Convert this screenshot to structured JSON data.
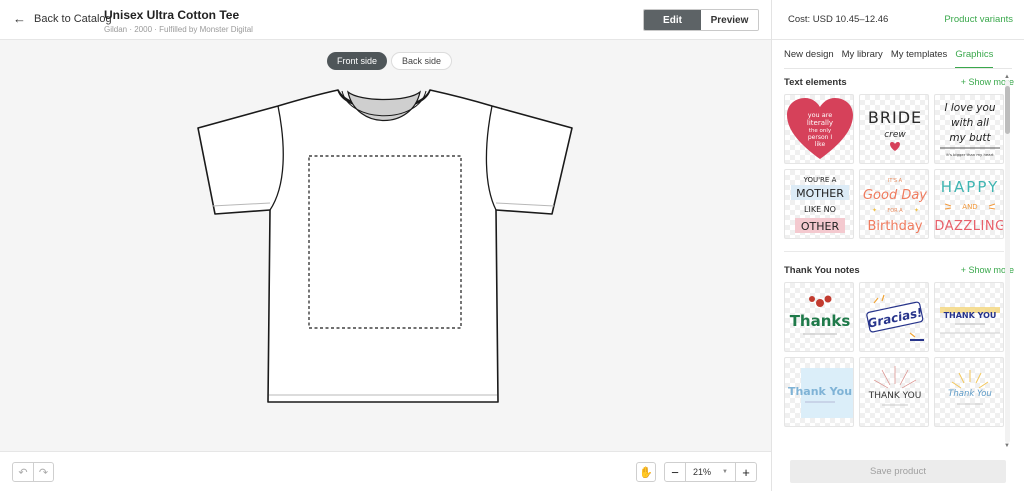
{
  "header": {
    "back_label": "Back to Catalog",
    "product_name": "Unisex Ultra Cotton Tee",
    "product_meta": "Gildan · 2000 · Fulfilled by Monster Digital",
    "edit_label": "Edit",
    "preview_label": "Preview"
  },
  "canvas": {
    "front_label": "Front side",
    "back_label": "Back side"
  },
  "bottom": {
    "zoom": "21%"
  },
  "panel": {
    "cost": "Cost: USD 10.45–12.46",
    "variants": "Product variants",
    "tabs": [
      "New design",
      "My library",
      "My templates",
      "Graphics"
    ],
    "save_label": "Save product",
    "sections": [
      {
        "title": "Text elements",
        "show_more": "+ Show more",
        "items": [
          {
            "kind": "heart",
            "lines": [
              "you are",
              "literally",
              "the only",
              "person I",
              "like"
            ]
          },
          {
            "kind": "bride",
            "lines": [
              "BRIDE",
              "crew"
            ]
          },
          {
            "kind": "butt",
            "lines": [
              "I love you",
              "with all",
              "my butt",
              "it's bigger than my heart"
            ]
          },
          {
            "kind": "mother",
            "lines": [
              "YOU'RE A",
              "MOTHER",
              "LIKE NO",
              "OTHER"
            ]
          },
          {
            "kind": "goodday",
            "lines": [
              "IT'S A",
              "Good Day",
              "FOR A",
              "Birthday"
            ]
          },
          {
            "kind": "happy",
            "lines": [
              "HAPPY",
              "AND",
              "DAZZLING"
            ]
          }
        ]
      },
      {
        "title": "Thank You notes",
        "show_more": "+ Show more",
        "items": [
          {
            "kind": "thanks",
            "lines": [
              "Thanks"
            ]
          },
          {
            "kind": "gracias",
            "lines": [
              "Gracias!"
            ]
          },
          {
            "kind": "thankyou-blue",
            "lines": [
              "THANK YOU"
            ]
          },
          {
            "kind": "thankyou-script",
            "lines": [
              "Thank You"
            ]
          },
          {
            "kind": "thankyou-burst",
            "lines": [
              "THANK YOU"
            ]
          },
          {
            "kind": "thankyou-sun",
            "lines": [
              "Thank You"
            ]
          }
        ]
      }
    ]
  },
  "colors": {
    "accent": "#3aa84c",
    "dark_button": "#5d6366",
    "heart": "#d6415a"
  }
}
